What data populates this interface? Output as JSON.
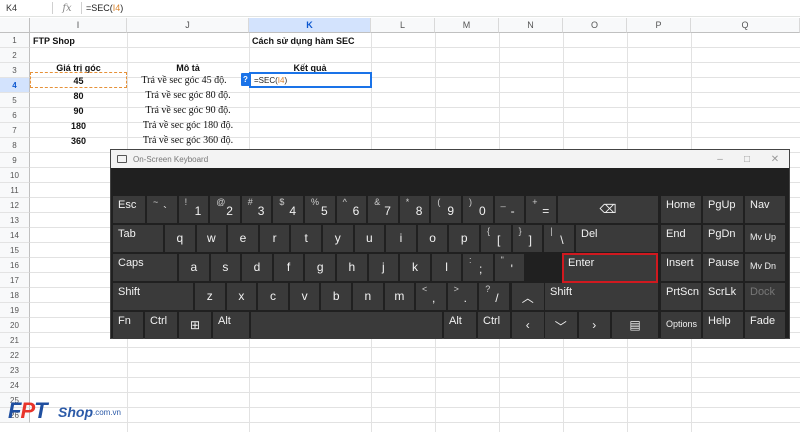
{
  "formula_bar": {
    "name_box": "K4",
    "fx": "fx",
    "formula_prefix": "=SEC(",
    "formula_ref": "I4",
    "formula_suffix": ")"
  },
  "columns": [
    "I",
    "J",
    "K",
    "L",
    "M",
    "N",
    "O",
    "P",
    "Q"
  ],
  "rows": [
    "1",
    "2",
    "3",
    "4",
    "5",
    "6",
    "7",
    "8",
    "9",
    "10",
    "11",
    "12",
    "13",
    "14",
    "15",
    "16",
    "17",
    "18",
    "19",
    "20",
    "21",
    "22",
    "23",
    "24",
    "25",
    "26"
  ],
  "sheet": {
    "i1": "FTP Shop",
    "k1": "Cách sử dụng hàm SEC",
    "i3": "Giá trị góc",
    "j3": "Mô tả",
    "k3": "Kết quả",
    "values": [
      "45",
      "80",
      "90",
      "180",
      "360"
    ],
    "descriptions": [
      "Trả về sec góc 45 độ.",
      "Trả về sec góc 80 độ.",
      "Trả về sec góc 90 độ.",
      "Trả về sec góc 180 độ.",
      "Trả về sec góc 360 độ."
    ],
    "editor_prefix": "=SEC(",
    "editor_ref": "I4",
    "editor_suffix": ")",
    "help_mark": "?"
  },
  "keyboard": {
    "title": "On-Screen Keyboard",
    "minimize": "–",
    "maximize": "□",
    "close": "✕",
    "row1": [
      {
        "sub": "",
        "main": "Esc"
      },
      {
        "sub": "~",
        "main": "`"
      },
      {
        "sub": "!",
        "main": "1"
      },
      {
        "sub": "@",
        "main": "2"
      },
      {
        "sub": "#",
        "main": "3"
      },
      {
        "sub": "$",
        "main": "4"
      },
      {
        "sub": "%",
        "main": "5"
      },
      {
        "sub": "^",
        "main": "6"
      },
      {
        "sub": "&",
        "main": "7"
      },
      {
        "sub": "*",
        "main": "8"
      },
      {
        "sub": "(",
        "main": "9"
      },
      {
        "sub": ")",
        "main": "0"
      },
      {
        "sub": "_",
        "main": "-"
      },
      {
        "sub": "+",
        "main": "="
      },
      {
        "sub": "",
        "main": "⌫"
      }
    ],
    "row2": [
      "Tab",
      "q",
      "w",
      "e",
      "r",
      "t",
      "y",
      "u",
      "i",
      "o",
      "p"
    ],
    "row2_extra": [
      {
        "sub": "{",
        "main": "["
      },
      {
        "sub": "}",
        "main": "]"
      },
      {
        "sub": "|",
        "main": "\\"
      }
    ],
    "del": "Del",
    "row3": [
      "Caps",
      "a",
      "s",
      "d",
      "f",
      "g",
      "h",
      "j",
      "k",
      "l"
    ],
    "row3_extra": [
      {
        "sub": ":",
        "main": ";"
      },
      {
        "sub": "\"",
        "main": "'"
      }
    ],
    "enter": "Enter",
    "row4": [
      "Shift",
      "z",
      "x",
      "c",
      "v",
      "b",
      "n",
      "m"
    ],
    "row4_extra": [
      {
        "sub": "<",
        "main": ","
      },
      {
        "sub": ">",
        "main": "."
      },
      {
        "sub": "?",
        "main": "/"
      }
    ],
    "up": "︿",
    "shift_right": "Shift",
    "row5": {
      "fn": "Fn",
      "ctrl": "Ctrl",
      "win": "⊞",
      "alt": "Alt",
      "alt_r": "Alt",
      "ctrl_r": "Ctrl",
      "left": "‹",
      "down": "﹀",
      "right": "›",
      "menu": "▤"
    },
    "nav": [
      "Home",
      "PgUp",
      "Nav",
      "End",
      "PgDn",
      "Mv Up",
      "Insert",
      "Pause",
      "Mv Dn",
      "PrtScn",
      "ScrLk",
      "Dock",
      "Options",
      "Help",
      "Fade"
    ]
  },
  "logo": {
    "fpt_f": "F",
    "fpt_p": "P",
    "fpt_t": "T",
    "shop": "Shop",
    "domain": ".com.vn"
  }
}
